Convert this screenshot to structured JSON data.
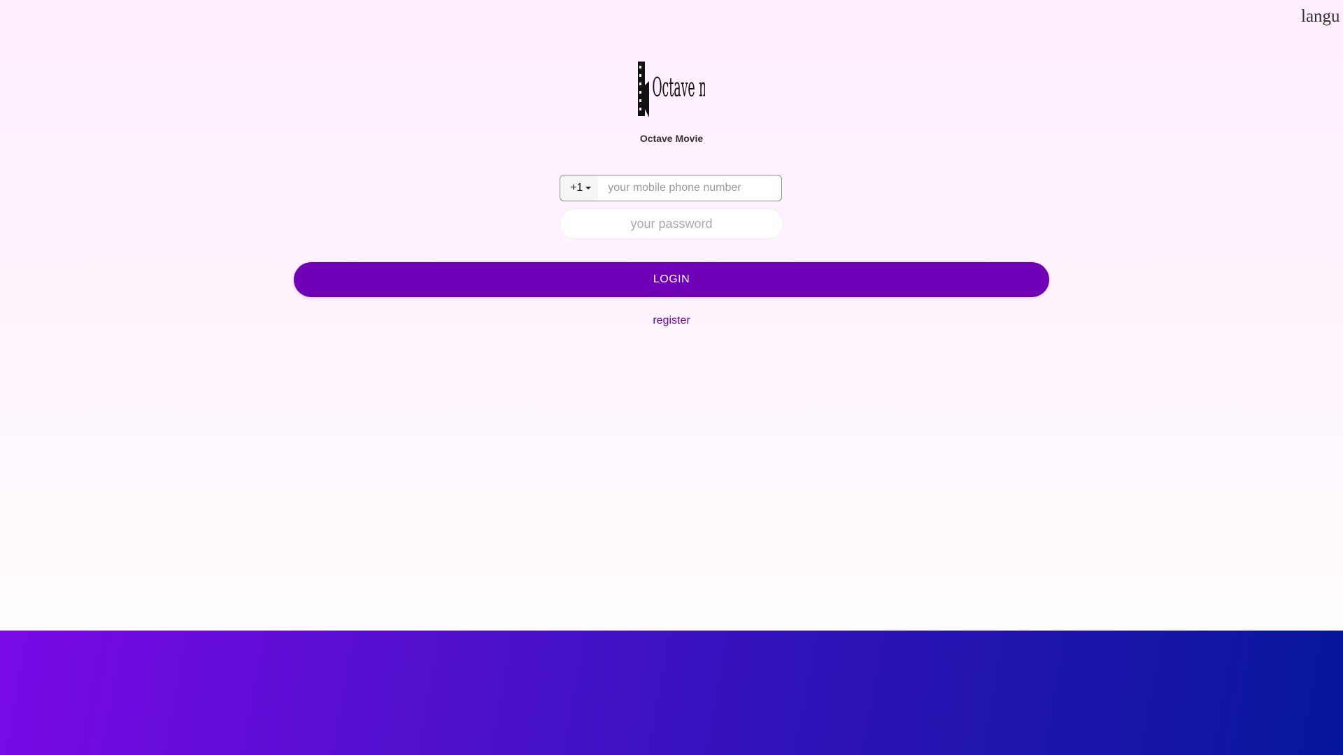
{
  "header": {
    "language_label": "langu"
  },
  "brand": {
    "logo_text": "Octave movie",
    "name": "Octave Movie"
  },
  "form": {
    "country_code": "+1",
    "phone_placeholder": "your mobile phone number",
    "password_placeholder": "your password",
    "login_label": "LOGIN",
    "register_label": "register"
  },
  "colors": {
    "accent": "#7000b8",
    "footer_start": "#7a0ae6",
    "footer_end": "#06169a"
  }
}
